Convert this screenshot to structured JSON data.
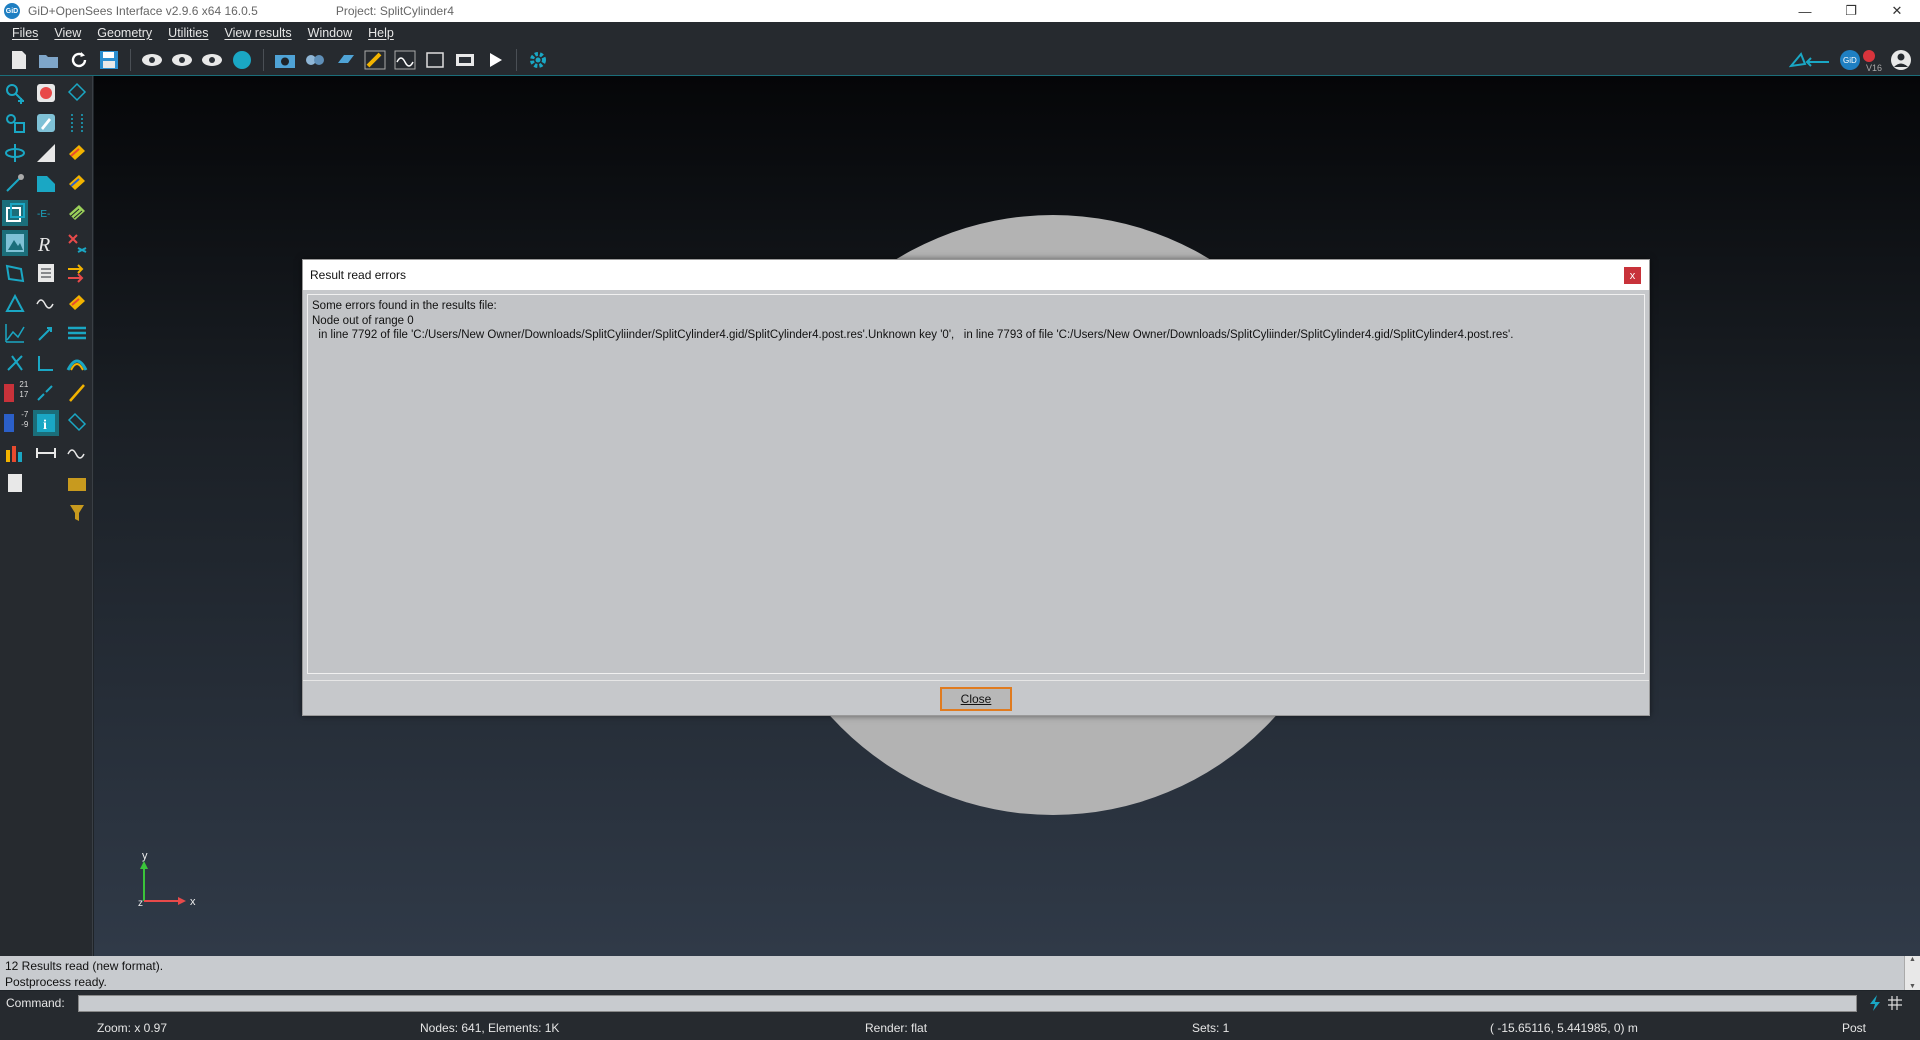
{
  "window": {
    "app_title": "GiD+OpenSees Interface v2.9.6  x64 16.0.5",
    "project_title": "Project: SplitCylinder4",
    "logo_text": "GiD",
    "controls": [
      "—",
      "❐",
      "✕"
    ]
  },
  "menu": [
    "Files",
    "View",
    "Geometry",
    "Utilities",
    "View results",
    "Window",
    "Help"
  ],
  "toolbar": {
    "badge": "V16"
  },
  "viewport": {
    "axis_labels": {
      "x": "x",
      "y": "y",
      "z": "z"
    },
    "legend_numbers": [
      "21",
      "17",
      "-7",
      "-9"
    ]
  },
  "dialog": {
    "title": "Result read errors",
    "close_x": "x",
    "lines": [
      "Some errors found in the results file:",
      "Node out of range 0",
      "  in line 7792 of file 'C:/Users/New Owner/Downloads/SplitCyliinder/SplitCylinder4.gid/SplitCylinder4.post.res'.Unknown key '0',   in line 7793 of file 'C:/Users/New Owner/Downloads/SplitCyliinder/SplitCylinder4.gid/SplitCylinder4.post.res'."
    ],
    "close_label": "Close"
  },
  "output": {
    "lines": [
      "12 Results read (new format).",
      "Postprocess ready."
    ]
  },
  "command": {
    "label": "Command:",
    "value": ""
  },
  "status": {
    "zoom": "Zoom: x 0.97",
    "nodes": "Nodes: 641, Elements: 1K",
    "render": "Render: flat",
    "sets": "Sets: 1",
    "coords": "( -15.65116,  5.441985,  0)  m",
    "mode": "Post"
  },
  "colors": {
    "accent": "#1aa7c4",
    "button_focus": "#e07b1f",
    "close_red": "#c8323a"
  }
}
